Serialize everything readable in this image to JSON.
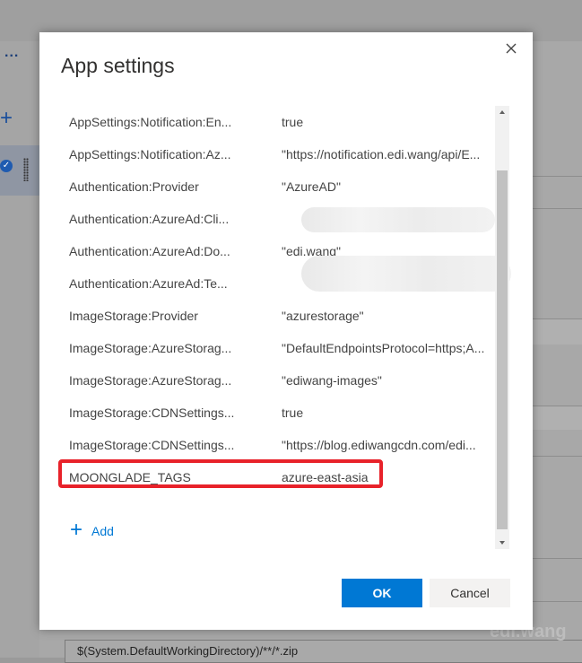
{
  "background": {
    "toolbar_overflow": "...",
    "add_glyph": "+",
    "bottom_field_text": "$(System.DefaultWorkingDirectory)/**/*.zip",
    "watermark": "edi.wang"
  },
  "dialog": {
    "title": "App settings",
    "close_icon": "close-icon",
    "settings": [
      {
        "name": "AppSettings:Notification:En...",
        "value": "true"
      },
      {
        "name": "AppSettings:Notification:Az...",
        "value": "\"https://notification.edi.wang/api/E..."
      },
      {
        "name": "Authentication:Provider",
        "value": "\"AzureAD\""
      },
      {
        "name": "Authentication:AzureAd:Cli...",
        "value": ""
      },
      {
        "name": "Authentication:AzureAd:Do...",
        "value": "\"edi.wang\""
      },
      {
        "name": "Authentication:AzureAd:Te...",
        "value": ""
      },
      {
        "name": "ImageStorage:Provider",
        "value": "\"azurestorage\""
      },
      {
        "name": "ImageStorage:AzureStorag...",
        "value": "\"DefaultEndpointsProtocol=https;A..."
      },
      {
        "name": "ImageStorage:AzureStorag...",
        "value": "\"ediwang-images\""
      },
      {
        "name": "ImageStorage:CDNSettings...",
        "value": "true"
      },
      {
        "name": "ImageStorage:CDNSettings...",
        "value": "\"https://blog.ediwangcdn.com/edi..."
      },
      {
        "name": "MOONGLADE_TAGS",
        "value": "azure-east-asia"
      }
    ],
    "add_label": "Add",
    "ok_label": "OK",
    "cancel_label": "Cancel"
  },
  "colors": {
    "accent": "#0078d4",
    "highlight": "#e8222a"
  }
}
